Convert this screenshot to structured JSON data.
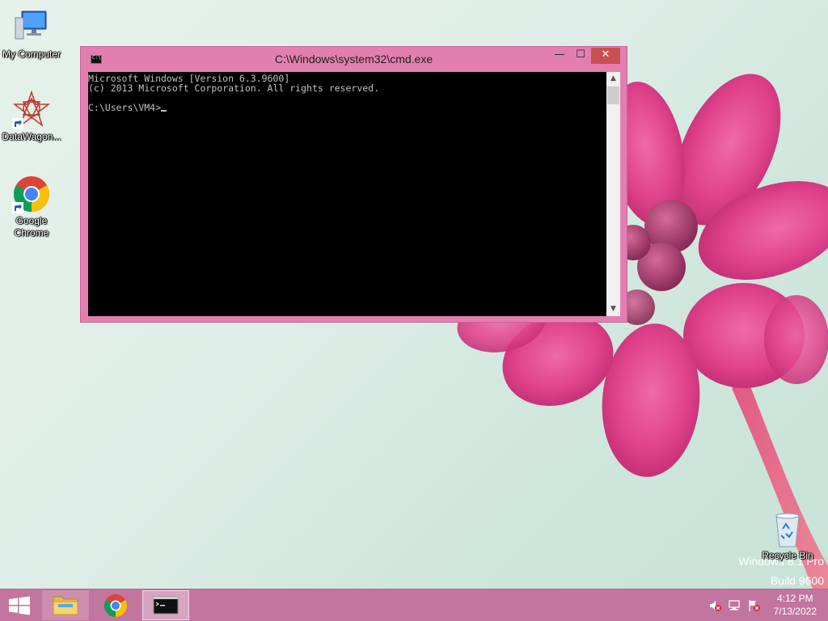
{
  "desktop_icons": [
    {
      "label": "My Computer",
      "icon": "computer-icon"
    },
    {
      "label": "DataWagon...",
      "icon": "datawagon-icon"
    },
    {
      "label": "Google Chrome",
      "icon": "chrome-icon"
    },
    {
      "label": "Recycle Bin",
      "icon": "recycle-bin-icon"
    }
  ],
  "cmd_window": {
    "title": "C:\\Windows\\system32\\cmd.exe",
    "title_icon_text": "C:\\",
    "minimize_symbol": "—",
    "maximize_symbol": "☐",
    "close_symbol": "✕",
    "console_lines": [
      "Microsoft Windows [Version 6.3.9600]",
      "(c) 2013 Microsoft Corporation. All rights reserved.",
      "",
      "C:\\Users\\VM4>"
    ],
    "scroll_up_symbol": "▲",
    "scroll_down_symbol": "▼"
  },
  "watermark": {
    "line1": "Windows 8.1 Pro",
    "line2": "Build 9600"
  },
  "taskbar": {
    "items": [
      {
        "name": "file-explorer",
        "icon": "folder-icon"
      },
      {
        "name": "google-chrome",
        "icon": "chrome-icon"
      },
      {
        "name": "command-prompt",
        "icon": "cmd-icon",
        "active": true
      }
    ],
    "tray": {
      "icons": [
        "speaker-muted-icon",
        "network-icon",
        "action-center-flag-icon"
      ]
    },
    "clock": {
      "time": "4:12 PM",
      "date": "7/13/2022"
    }
  },
  "colors": {
    "window_frame": "#e27fb0",
    "close_button": "#c75050",
    "taskbar": "#c2759e",
    "console_bg": "#000000",
    "console_text": "#c0c0c0"
  }
}
